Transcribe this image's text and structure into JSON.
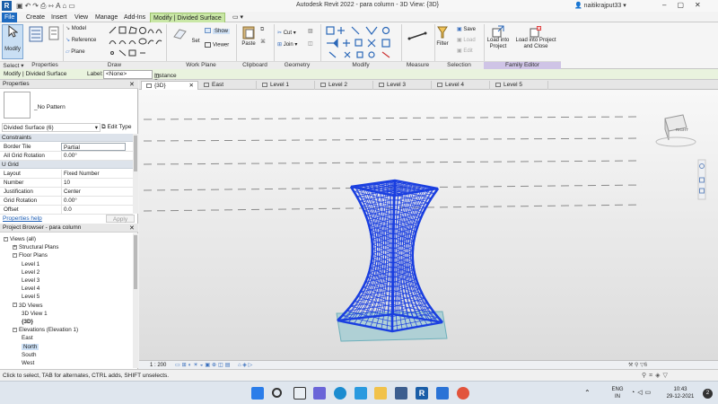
{
  "titlebar": {
    "app_logo": "R",
    "title": "Autodesk Revit 2022 - para column - 3D View: {3D}",
    "user": "naitikrajput33",
    "icons": [
      "save-icon",
      "undo-icon",
      "redo-icon",
      "print-icon",
      "measure-icon",
      "text-icon",
      "default-3d-view-icon",
      "close-hidden-icon",
      "switch-windows-icon"
    ]
  },
  "ribbon_tabs": [
    "File",
    "Create",
    "Insert",
    "View",
    "Manage",
    "Add-Ins",
    "Modify | Divided Surface"
  ],
  "ribbon": {
    "modify_label": "Modify",
    "select_label": "Select ▾",
    "properties_label": "Properties",
    "draw": {
      "model": "Model",
      "reference": "Reference",
      "plane": "Plane",
      "label": "Draw"
    },
    "work_plane": {
      "set": "Set",
      "show": "Show",
      "viewer": "Viewer",
      "label": "Work Plane"
    },
    "clipboard": {
      "paste": "Paste",
      "cut": "Cut",
      "join": "Join",
      "label": "Clipboard"
    },
    "geometry_label": "Geometry",
    "modify_panel_label": "Modify",
    "measure_label": "Measure",
    "selection": {
      "filter": "Filter",
      "save": "Save",
      "load": "Load",
      "edit": "Edit",
      "label": "Selection"
    },
    "family_editor": {
      "load_into_project": "Load into Project",
      "load_into_project_close": "Load into Project and Close",
      "label": "Family Editor"
    }
  },
  "options_bar": {
    "context": "Modify | Divided Surface",
    "label_text": "Label:",
    "label_value": "<None>",
    "instance_parameter": "Instance Parameter"
  },
  "properties": {
    "header": "Properties",
    "type_name": "_No Pattern",
    "selector": "Divided Surface (6)",
    "edit_type": "Edit Type",
    "groups": [
      {
        "name": "Constraints",
        "rows": [
          {
            "k": "Border Tile",
            "v": "Partial"
          },
          {
            "k": "All Grid Rotation",
            "v": "0.00°"
          }
        ]
      },
      {
        "name": "U Grid",
        "rows": [
          {
            "k": "Layout",
            "v": "Fixed Number"
          },
          {
            "k": "Number",
            "v": "10"
          },
          {
            "k": "Justification",
            "v": "Center"
          },
          {
            "k": "Grid Rotation",
            "v": "0.00°"
          },
          {
            "k": "Offset",
            "v": "0.0"
          }
        ]
      }
    ],
    "help_link": "Properties help",
    "apply": "Apply"
  },
  "browser": {
    "header": "Project Browser - para column",
    "tree": [
      {
        "level": 0,
        "toggle": "-",
        "label": "Views (all)"
      },
      {
        "level": 1,
        "toggle": "+",
        "label": "Structural Plans"
      },
      {
        "level": 1,
        "toggle": "-",
        "label": "Floor Plans"
      },
      {
        "level": 2,
        "toggle": "",
        "label": "Level 1"
      },
      {
        "level": 2,
        "toggle": "",
        "label": "Level 2"
      },
      {
        "level": 2,
        "toggle": "",
        "label": "Level 3"
      },
      {
        "level": 2,
        "toggle": "",
        "label": "Level 4"
      },
      {
        "level": 2,
        "toggle": "",
        "label": "Level 5"
      },
      {
        "level": 1,
        "toggle": "-",
        "label": "3D Views"
      },
      {
        "level": 2,
        "toggle": "",
        "label": "3D View 1"
      },
      {
        "level": 2,
        "toggle": "",
        "label": "{3D}",
        "bold": true
      },
      {
        "level": 1,
        "toggle": "-",
        "label": "Elevations (Elevation 1)"
      },
      {
        "level": 2,
        "toggle": "",
        "label": "East"
      },
      {
        "level": 2,
        "toggle": "",
        "label": "North",
        "selected": true
      },
      {
        "level": 2,
        "toggle": "",
        "label": "South"
      },
      {
        "level": 2,
        "toggle": "",
        "label": "West"
      }
    ]
  },
  "view_tabs": [
    "{3D}",
    "East",
    "Level 1",
    "Level 2",
    "Level 3",
    "Level 4",
    "Level 5"
  ],
  "viewcube": {
    "face": "RIGHT"
  },
  "view_control": {
    "scale": "1 : 200",
    "worksets_count": "6"
  },
  "status": {
    "message": "Click to select, TAB for alternates, CTRL adds, SHIFT unselects."
  },
  "taskbar": {
    "lang_top": "ENG",
    "lang_bottom": "IN",
    "time": "10:43",
    "date": "29-12-2021",
    "notification_count": "2"
  },
  "colors": {
    "accent": "#1e6bc1",
    "contextual_tab": "#c9e7a6",
    "mesh": "#1a3fe0",
    "floor_plane": "#8fc7cf"
  }
}
